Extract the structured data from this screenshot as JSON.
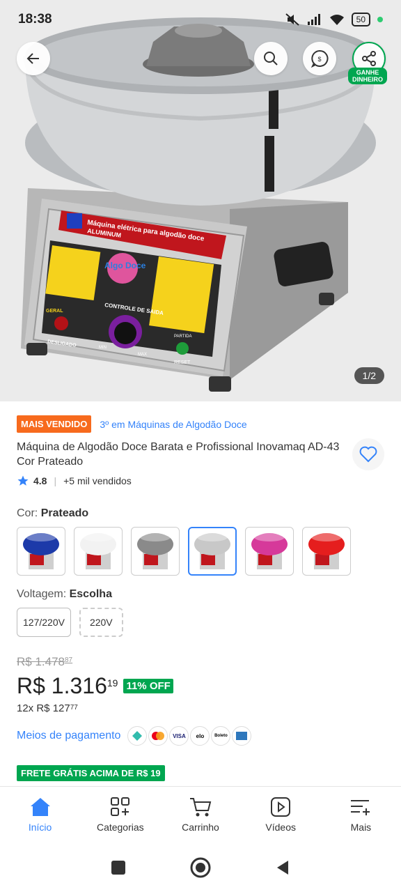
{
  "status_bar": {
    "time": "18:38",
    "battery": "50"
  },
  "hero": {
    "counter": "1/2",
    "ganhe_label_1": "GANHE",
    "ganhe_label_2": "DINHEIRO",
    "product_print": {
      "brand": "Máquina elétrica para algodão doce",
      "brand_sub": "ALUMINUM",
      "logo_text": "Algo Doce",
      "control_label": "CONTROLE DE SAIDA",
      "power_label": "GERAL",
      "off_label": "DESLIGADO",
      "min": "MIN",
      "max": "MAX",
      "start": "PARTIDA",
      "reset": "RESET"
    }
  },
  "product": {
    "badge_best": "MAIS VENDIDO",
    "rank_text": "3º em Máquinas de Algodão Doce",
    "title": "Máquina de Algodão Doce Barata e Profissional Inovamaq AD-43 Cor Prateado",
    "rating": "4.8",
    "sold": "+5 mil vendidos",
    "color_label": "Cor:",
    "color_value": "Prateado",
    "swatches": [
      {
        "name": "azul",
        "color": "#1c3aa9"
      },
      {
        "name": "branco",
        "color": "#f2f2f2"
      },
      {
        "name": "cinza",
        "color": "#8a8a8a"
      },
      {
        "name": "prateado",
        "color": "#c8c8c8"
      },
      {
        "name": "rosa",
        "color": "#d6399a"
      },
      {
        "name": "vermelho",
        "color": "#e51e1e"
      }
    ],
    "voltage_label": "Voltagem:",
    "voltage_value": "Escolha",
    "voltage_options": [
      "127/220V",
      "220V"
    ],
    "old_price": "R$ 1.478",
    "old_price_cents": "87",
    "price": "R$ 1.316",
    "price_cents": "19",
    "discount": "11% OFF",
    "installments": "12x R$ 127",
    "installments_cents": "77",
    "payment_link": "Meios de pagamento",
    "payment_icons": [
      "pix",
      "mastercard",
      "VISA",
      "elo",
      "Boleto",
      "amex"
    ],
    "frete": "FRETE GRÁTIS ACIMA DE R$ 19"
  },
  "nav": {
    "items": [
      {
        "label": "Início",
        "icon": "home-icon",
        "active": true
      },
      {
        "label": "Categorias",
        "icon": "categories-icon"
      },
      {
        "label": "Carrinho",
        "icon": "cart-icon"
      },
      {
        "label": "Vídeos",
        "icon": "video-icon"
      },
      {
        "label": "Mais",
        "icon": "menu-plus-icon"
      }
    ]
  },
  "colors": {
    "accent": "#3483fa",
    "green": "#00a650",
    "orange": "#f76a1d"
  }
}
